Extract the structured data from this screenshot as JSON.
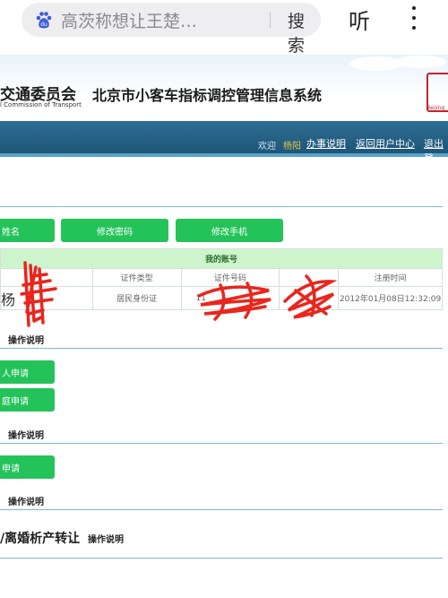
{
  "browser": {
    "search_query": "高茨称想让王楚…",
    "search_label": "搜索",
    "listen_label": "听",
    "icons": [
      "baidu-paw-icon",
      "more-vertical-icon"
    ]
  },
  "header": {
    "commission_cn": "交通委员会",
    "commission_en": "l Commission of Transport",
    "system_title": "北京市小客车指标调控管理信息系统",
    "seal_text": "Beijing"
  },
  "nav": {
    "welcome": "欢迎",
    "user": "杨阳",
    "links": [
      "办事说明",
      "返回用户中心",
      "退出登"
    ]
  },
  "actions": {
    "change_name": "姓名",
    "change_password": "修改密码",
    "change_phone": "修改手机"
  },
  "account": {
    "title": "我的账号",
    "headers": [
      "",
      "证件类型",
      "证件号码",
      "",
      "注册时间"
    ],
    "row": {
      "name": "杨",
      "id_type": "居民身份证",
      "id_number": "11",
      "phone": "1",
      "registered": "2012年01月08日12:32:09"
    }
  },
  "sections": {
    "op_label": "操作说明",
    "personal_apply": "人申请",
    "family_apply": "庭申请",
    "unit_apply": "申请",
    "transfer_title": "/离婚析产转让",
    "transfer_op": "操作说明"
  },
  "colors": {
    "nav_bar": "#1e5577",
    "button_green": "#24c35a",
    "table_title_bg": "#cdf5cd",
    "username": "#e7c54a",
    "redaction": "#e8261e"
  }
}
